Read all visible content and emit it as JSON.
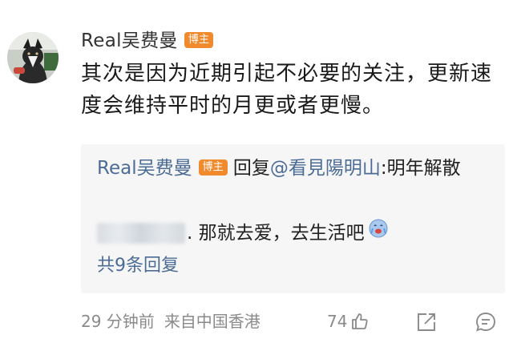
{
  "comment": {
    "username": "Real吴费曼",
    "badge": "博主",
    "text": "其次是因为近期引起不必要的关注，更新速度会维持平时的月更或者更慢。"
  },
  "reply": {
    "username": "Real吴费曼",
    "badge": "博主",
    "reply_word": "回复",
    "mention": "@看見陽明山",
    "quoted": ":明年解散",
    "reply_text": ". 那就去爱，去生活吧",
    "more_label": "共9条回复"
  },
  "footer": {
    "time": "29 分钟前",
    "source": "来自中国香港",
    "like_count": "74"
  },
  "icons": {
    "like": "thumbs-up-icon",
    "share": "share-icon",
    "comment": "comment-icon",
    "emoji": "crying-emoji-icon"
  },
  "colors": {
    "badge": "#f08a2c",
    "link": "#4c6c96",
    "reply_bg": "#f6f6f6"
  }
}
